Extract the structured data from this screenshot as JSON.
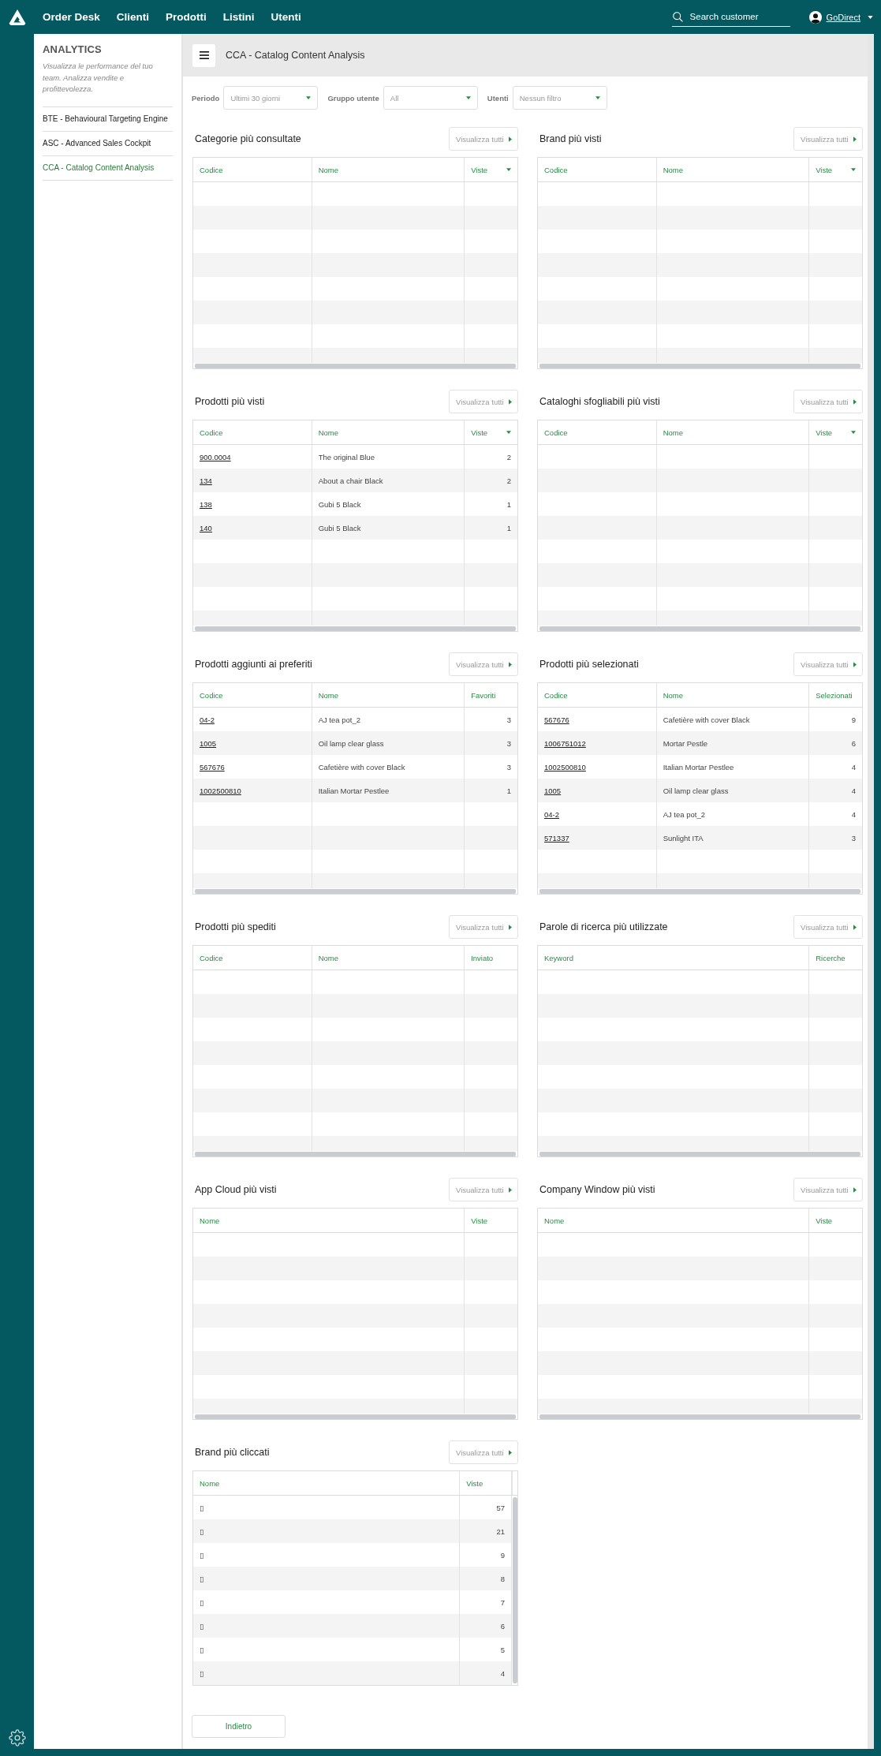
{
  "top_nav": {
    "items": [
      "Order Desk",
      "Clienti",
      "Prodotti",
      "Listini",
      "Utenti"
    ]
  },
  "search": {
    "placeholder": "Search customer"
  },
  "user": {
    "name": "GoDirect"
  },
  "sidebar": {
    "title": "ANALYTICS",
    "description": "Visualizza le performance del tuo team. Analizza vendite e profittevolezza.",
    "items": [
      {
        "label": "BTE - Behavioural Targeting Engine",
        "selected": false
      },
      {
        "label": "ASC - Advanced Sales Cockpit",
        "selected": false
      },
      {
        "label": "CCA - Catalog Content Analysis",
        "selected": true
      }
    ]
  },
  "page_header": {
    "title": "CCA - Catalog Content Analysis"
  },
  "filters": [
    {
      "label": "Periodo",
      "value": "Ultimi 30 giorni"
    },
    {
      "label": "Gruppo utente",
      "value": "All"
    },
    {
      "label": "Utenti",
      "value": "Nessun filtro"
    }
  ],
  "panels": [
    {
      "title": "Categorie più consultate",
      "button": "Visualizza tutti",
      "columns": [
        {
          "label": "Codice",
          "kind": "link",
          "sorted": false
        },
        {
          "label": "Nome",
          "kind": "text",
          "sorted": false
        },
        {
          "label": "Viste",
          "kind": "number",
          "sorted": true
        }
      ]
    },
    {
      "title": "Brand più visti",
      "button": "Visualizza tutti",
      "columns": [
        {
          "label": "Codice",
          "kind": "link",
          "sorted": false
        },
        {
          "label": "Nome",
          "kind": "text",
          "sorted": false
        },
        {
          "label": "Viste",
          "kind": "number",
          "sorted": true
        }
      ]
    },
    {
      "title": "Prodotti più visti",
      "button": "Visualizza tutti",
      "columns": [
        {
          "label": "Codice",
          "kind": "link",
          "sorted": false
        },
        {
          "label": "Nome",
          "kind": "text",
          "sorted": false
        },
        {
          "label": "Viste",
          "kind": "number",
          "sorted": true
        }
      ],
      "rows": [
        [
          "900.0004",
          "The original Blue",
          "2"
        ],
        [
          "134",
          "About a chair Black",
          "2"
        ],
        [
          "138",
          "Gubi 5 Black",
          "1"
        ],
        [
          "140",
          "Gubi 5 Black",
          "1"
        ]
      ]
    },
    {
      "title": "Cataloghi sfogliabili più visti",
      "button": "Visualizza tutti",
      "columns": [
        {
          "label": "Codice",
          "kind": "link",
          "sorted": false
        },
        {
          "label": "Nome",
          "kind": "text",
          "sorted": false
        },
        {
          "label": "Viste",
          "kind": "number",
          "sorted": true
        }
      ]
    },
    {
      "title": "Prodotti aggiunti ai preferiti",
      "button": "Visualizza tutti",
      "columns": [
        {
          "label": "Codice",
          "kind": "link",
          "sorted": false
        },
        {
          "label": "Nome",
          "kind": "text",
          "sorted": false
        },
        {
          "label": "Favoriti",
          "kind": "number",
          "sorted": false
        }
      ],
      "rows": [
        [
          "04-2",
          "AJ tea pot_2",
          "3"
        ],
        [
          "1005",
          "Oil lamp clear glass",
          "3"
        ],
        [
          "567676",
          "Cafetière with cover Black",
          "3"
        ],
        [
          "1002500810",
          "Italian Mortar Pestlee",
          "1"
        ]
      ]
    },
    {
      "title": "Prodotti più selezionati",
      "button": "Visualizza tutti",
      "columns": [
        {
          "label": "Codice",
          "kind": "link",
          "sorted": false
        },
        {
          "label": "Nome",
          "kind": "text",
          "sorted": false
        },
        {
          "label": "Selezionati",
          "kind": "number",
          "sorted": false
        }
      ],
      "rows": [
        [
          "567676",
          "Cafetière with cover Black",
          "9"
        ],
        [
          "1006751012",
          "Mortar Pestle",
          "6"
        ],
        [
          "1002500810",
          "Italian Mortar Pestlee",
          "4"
        ],
        [
          "1005",
          "Oil lamp clear glass",
          "4"
        ],
        [
          "04-2",
          "AJ tea pot_2",
          "4"
        ],
        [
          "571337",
          "Sunlight ITA",
          "3"
        ]
      ]
    },
    {
      "title": "Prodotti più spediti",
      "button": "Visualizza tutti",
      "columns": [
        {
          "label": "Codice",
          "kind": "link",
          "sorted": false
        },
        {
          "label": "Nome",
          "kind": "text",
          "sorted": false
        },
        {
          "label": "Inviato",
          "kind": "number",
          "sorted": false
        }
      ]
    },
    {
      "title": "Parole di ricerca più utilizzate",
      "button": "Visualizza tutti",
      "columns": [
        {
          "label": "Keyword",
          "kind": "text",
          "sorted": false
        },
        {
          "label": "Ricerche",
          "kind": "number",
          "sorted": false
        }
      ]
    },
    {
      "title": "App Cloud più visti",
      "button": "Visualizza tutti",
      "columns": [
        {
          "label": "Nome",
          "kind": "text",
          "sorted": false
        },
        {
          "label": "Viste",
          "kind": "number",
          "sorted": false
        }
      ]
    },
    {
      "title": "Company Window più visti",
      "button": "Visualizza tutti",
      "columns": [
        {
          "label": "Nome",
          "kind": "text",
          "sorted": false
        },
        {
          "label": "Viste",
          "kind": "number",
          "sorted": false
        }
      ]
    },
    {
      "title": "Brand più cliccati",
      "button": "Visualizza tutti",
      "columns": [
        {
          "label": "Nome",
          "kind": "text",
          "sorted": false
        },
        {
          "label": "Viste",
          "kind": "number",
          "sorted": false
        }
      ],
      "rows": [
        [
          "▯",
          "57"
        ],
        [
          "▯",
          "21"
        ],
        [
          "▯",
          "9"
        ],
        [
          "▯",
          "8"
        ],
        [
          "▯",
          "7"
        ],
        [
          "▯",
          "6"
        ],
        [
          "▯",
          "5"
        ],
        [
          "▯",
          "4"
        ]
      ]
    }
  ],
  "back_button": "Indietro"
}
